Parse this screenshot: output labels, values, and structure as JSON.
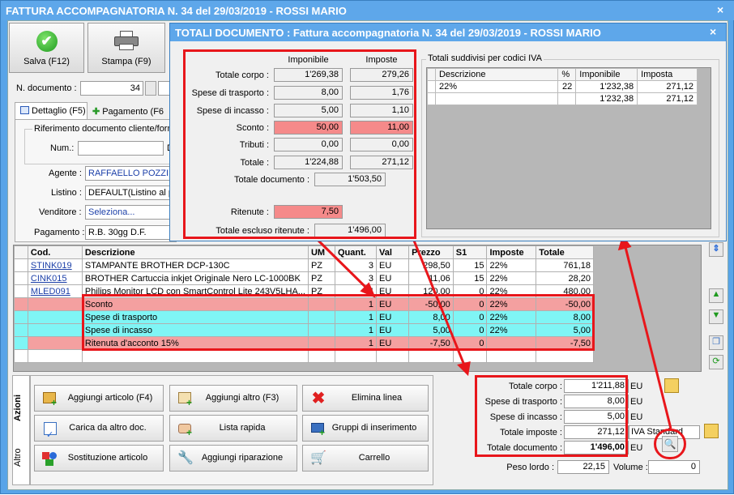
{
  "window": {
    "title": "FATTURA ACCOMPAGNATORIA N. 34 del 29/03/2019 - ROSSI MARIO",
    "close": "×"
  },
  "toolbar": {
    "save_label": "Salva (F12)",
    "print_label": "Stampa (F9)"
  },
  "doc": {
    "number_label": "N. documento :",
    "number_value": "34"
  },
  "tabs": {
    "dettaglio": "Dettaglio (F5)",
    "pagamento": "Pagamento (F6"
  },
  "riferimento": {
    "legend": "Riferimento documento cliente/forni",
    "num_label": "Num.:",
    "d_label": "D"
  },
  "fields": {
    "agente_label": "Agente :",
    "agente_value": "RAFFAELLO POZZI",
    "listino_label": "Listino :",
    "listino_value": "DEFAULT(Listino al pu",
    "venditore_label": "Venditore :",
    "venditore_value": "Seleziona...",
    "pagamento_label": "Pagamento :",
    "pagamento_value": "R.B. 30gg D.F."
  },
  "table": {
    "headers": [
      "Cod.",
      "Descrizione",
      "UM",
      "Quant.",
      "Val",
      "Prezzo",
      "S1",
      "Imposte",
      "Totale"
    ],
    "rows": [
      {
        "cod": "STINK019",
        "desc": "STAMPANTE BROTHER DCP-130C",
        "um": "PZ",
        "q": "3",
        "val": "EU",
        "prezzo": "298,50",
        "s1": "15",
        "imp": "22%",
        "tot": "761,18"
      },
      {
        "cod": "CINK015",
        "desc": "BROTHER Cartuccia inkjet Originale Nero LC-1000BK",
        "um": "PZ",
        "q": "3",
        "val": "EU",
        "prezzo": "11,06",
        "s1": "15",
        "imp": "22%",
        "tot": "28,20"
      },
      {
        "cod": "MLED091",
        "desc": "Philips Monitor LCD con SmartControl Lite 243V5LHA...",
        "um": "PZ",
        "q": "4",
        "val": "EU",
        "prezzo": "120,00",
        "s1": "0",
        "imp": "22%",
        "tot": "480,00"
      },
      {
        "cod": "",
        "desc": "Sconto",
        "um": "",
        "q": "1",
        "val": "EU",
        "prezzo": "-50,00",
        "s1": "0",
        "imp": "22%",
        "tot": "-50,00"
      },
      {
        "cod": "",
        "desc": "Spese di trasporto",
        "um": "",
        "q": "1",
        "val": "EU",
        "prezzo": "8,00",
        "s1": "0",
        "imp": "22%",
        "tot": "8,00"
      },
      {
        "cod": "",
        "desc": "Spese di incasso",
        "um": "",
        "q": "1",
        "val": "EU",
        "prezzo": "5,00",
        "s1": "0",
        "imp": "22%",
        "tot": "5,00"
      },
      {
        "cod": "",
        "desc": "Ritenuta d'acconto 15%",
        "um": "",
        "q": "1",
        "val": "EU",
        "prezzo": "-7,50",
        "s1": "0",
        "imp": "",
        "tot": "-7,50"
      }
    ]
  },
  "actions": {
    "tab_azioni": "Azioni",
    "tab_altro": "Altro",
    "aggiungi_articolo": "Aggiungi articolo (F4)",
    "aggiungi_altro": "Aggiungi altro (F3)",
    "elimina_linea": "Elimina linea",
    "carica_altro": "Carica da altro doc.",
    "lista_rapida": "Lista rapida",
    "gruppi": "Gruppi di inserimento",
    "sostituzione": "Sostituzione articolo",
    "riparazione": "Aggiungi riparazione",
    "carrello": "Carrello"
  },
  "summary": {
    "corpo_label": "Totale corpo :",
    "corpo_value": "1'211,88",
    "corpo_cur": "EU",
    "trasporto_label": "Spese di trasporto :",
    "trasporto_value": "8,00",
    "trasporto_cur": "EU",
    "incasso_label": "Spese di incasso :",
    "incasso_value": "5,00",
    "incasso_cur": "EU",
    "imposte_label": "Totale imposte :",
    "imposte_value": "271,12",
    "imposte_cur": "IVA Standard",
    "documento_label": "Totale documento :",
    "documento_value": "1'496,00",
    "documento_cur": "EU",
    "peso_label": "Peso lordo :",
    "peso_value": "22,15",
    "volume_label": "Volume :",
    "volume_value": "0"
  },
  "dialog": {
    "title": "TOTALI DOCUMENTO : Fattura accompagnatoria N. 34 del 29/03/2019 - ROSSI MARIO",
    "close": "×",
    "col_imponibile": "Imponibile",
    "col_imposte": "Imposte",
    "rows": [
      {
        "label": "Totale corpo :",
        "imponibile": "1'269,38",
        "imposte": "279,26"
      },
      {
        "label": "Spese di trasporto :",
        "imponibile": "8,00",
        "imposte": "1,76"
      },
      {
        "label": "Spese di incasso :",
        "imponibile": "5,00",
        "imposte": "1,10"
      },
      {
        "label": "Sconto :",
        "imponibile": "50,00",
        "imposte": "11,00"
      },
      {
        "label": "Tributi :",
        "imponibile": "0,00",
        "imposte": "0,00"
      },
      {
        "label": "Totale :",
        "imponibile": "1'224,88",
        "imposte": "271,12"
      }
    ],
    "totale_doc_label": "Totale documento :",
    "totale_doc_value": "1'503,50",
    "ritenute_label": "Ritenute :",
    "ritenute_value": "7,50",
    "escluso_label": "Totale escluso ritenute :",
    "escluso_value": "1'496,00",
    "iva_legend": "Totali suddivisi per codici IVA",
    "iva_headers": [
      "Descrizione",
      "%",
      "Imponibile",
      "Imposta"
    ],
    "iva_rows": [
      {
        "desc": "22%",
        "pct": "22",
        "imp": "1'232,38",
        "tax": "271,12"
      },
      {
        "desc": "",
        "pct": "",
        "imp": "1'232,38",
        "tax": "271,12"
      }
    ]
  }
}
